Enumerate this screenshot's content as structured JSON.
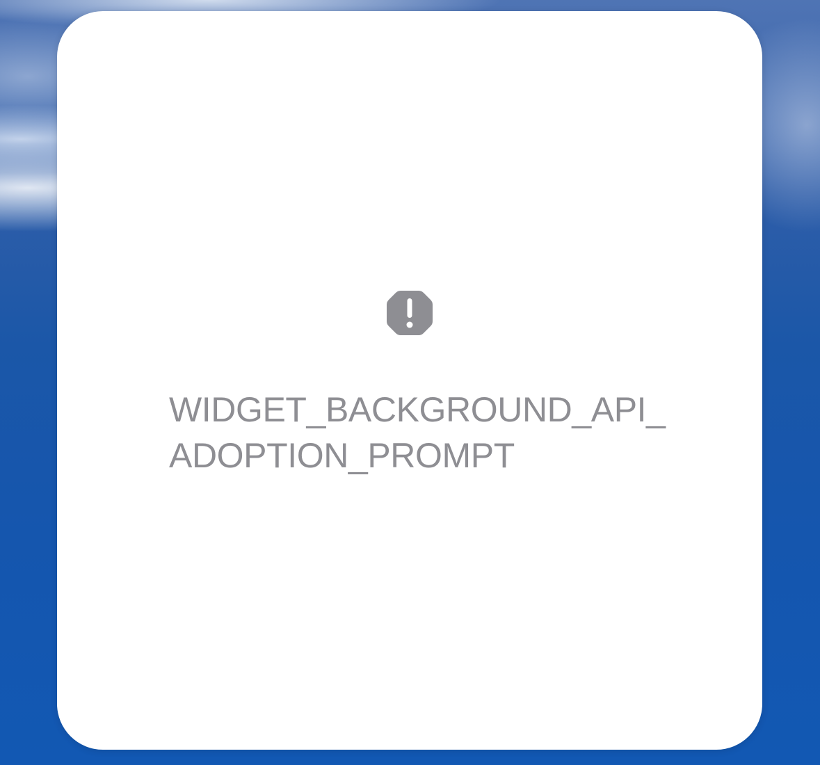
{
  "widget": {
    "icon": "exclamationmark-octagon-icon",
    "message_lines": [
      "WIDGET_BACKGROUND_API_",
      "ADOPTION_PROMPT"
    ]
  },
  "colors": {
    "card_background": "#ffffff",
    "message_text": "#8e8e93",
    "icon_fill": "#8e8e93",
    "wallpaper_sky": "#1556ae"
  }
}
